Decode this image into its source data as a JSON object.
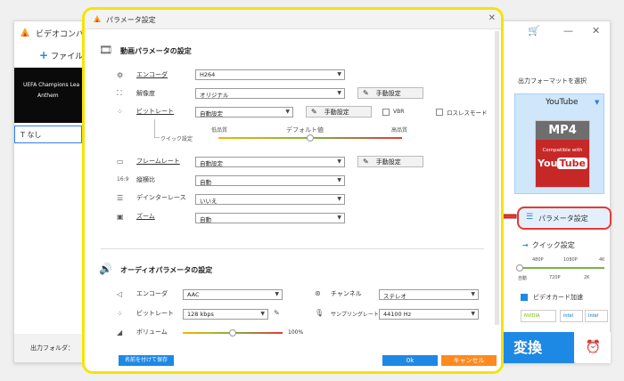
{
  "main_window": {
    "title": "ビデオコンバ",
    "add_file": "ファイル",
    "thumbnail_title": "UEFA Champions Lea",
    "thumbnail_sub": "Anthem",
    "subtitle_value": "なし",
    "output_folder_label": "出力フォルダ：",
    "cart_icon": "cart-icon",
    "minimize": "—",
    "close": "✕"
  },
  "right_panel": {
    "output_format_title": "出力フォーマットを選択",
    "format_name": "YouTube",
    "format_badge": "MP4",
    "compatible_with": "Compatible with",
    "yt_you": "You",
    "yt_tube": "Tube",
    "param_button": "パラメータ設定",
    "quick_setting": "クイック設定",
    "quick_top_labels": [
      "480P",
      "1080P",
      "4K"
    ],
    "quick_bottom_labels": [
      "自動",
      "720P",
      "2K"
    ],
    "gpu_accel": "ビデオカード加速",
    "vendors": [
      "NVIDIA",
      "intel",
      "Intel"
    ],
    "convert": "変換"
  },
  "dialog": {
    "title": "パラメータ設定",
    "close": "✕",
    "video_section": "動画パラメータの設定",
    "audio_section": "オーディオパラメータの設定",
    "video": {
      "encoder_label": "エンコーダ",
      "encoder_value": "H264",
      "resolution_label": "解像度",
      "resolution_value": "オリジナル",
      "bitrate_label": "ビットレート",
      "bitrate_value": "自動設定",
      "vbr_label": "VBR",
      "lossless_label": "ロスレスモード",
      "quick_setting_label": "クイック設定",
      "quality_low": "低品質",
      "quality_default": "デフォルト値",
      "quality_high": "高品質",
      "framerate_label": "フレームレート",
      "framerate_value": "自動設定",
      "aspect_label": "縦横比",
      "aspect_value": "自動",
      "deinterlace_label": "デインターレース",
      "deinterlace_value": "いいえ",
      "zoom_label": "ズーム",
      "zoom_value": "自動",
      "manual_button": "手動設定"
    },
    "audio": {
      "encoder_label": "エンコーダ",
      "encoder_value": "AAC",
      "channel_label": "チャンネル",
      "channel_value": "ステレオ",
      "bitrate_label": "ビットレート",
      "bitrate_value": "128 kbps",
      "samplerate_label": "サンプリングレート",
      "samplerate_value": "44100 Hz",
      "volume_label": "ボリューム",
      "volume_value": "100%",
      "volume_level": 0.5
    },
    "save_as": "名前を付けて保存",
    "ok": "0k",
    "cancel": "キャンセル"
  }
}
